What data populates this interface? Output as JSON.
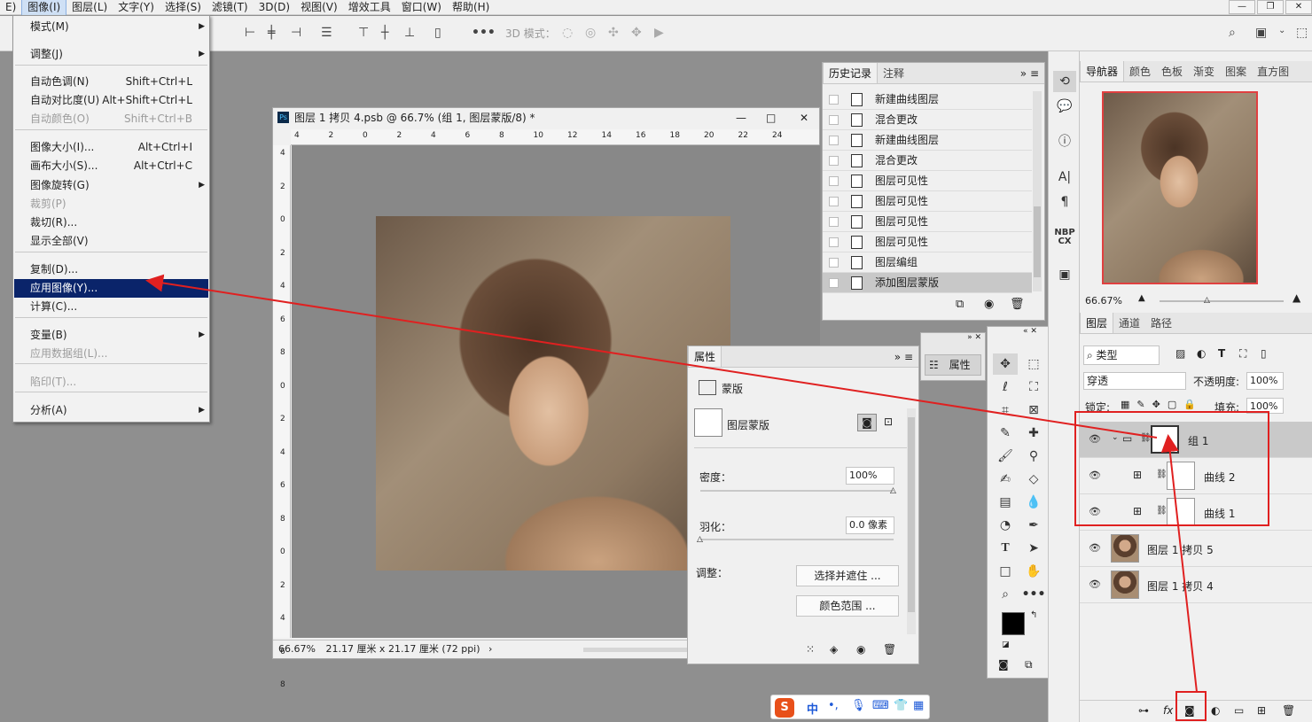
{
  "menubar": {
    "items": [
      "E)",
      "图像(I)",
      "图层(L)",
      "文字(Y)",
      "选择(S)",
      "滤镜(T)",
      "3D(D)",
      "视图(V)",
      "增效工具",
      "窗口(W)",
      "帮助(H)"
    ]
  },
  "options_bar": {
    "mode_label": "3D 模式："
  },
  "image_menu": {
    "items": [
      {
        "label": "模式(M)",
        "shortcut": "",
        "submenu": true,
        "disabled": false
      },
      {
        "label": "调整(J)",
        "shortcut": "",
        "submenu": true,
        "disabled": false
      },
      {
        "label": "自动色调(N)",
        "shortcut": "Shift+Ctrl+L",
        "submenu": false,
        "disabled": false
      },
      {
        "label": "自动对比度(U)",
        "shortcut": "Alt+Shift+Ctrl+L",
        "submenu": false,
        "disabled": false
      },
      {
        "label": "自动颜色(O)",
        "shortcut": "Shift+Ctrl+B",
        "submenu": false,
        "disabled": true
      },
      {
        "label": "图像大小(I)...",
        "shortcut": "Alt+Ctrl+I",
        "submenu": false,
        "disabled": false
      },
      {
        "label": "画布大小(S)...",
        "shortcut": "Alt+Ctrl+C",
        "submenu": false,
        "disabled": false
      },
      {
        "label": "图像旋转(G)",
        "shortcut": "",
        "submenu": true,
        "disabled": false
      },
      {
        "label": "裁剪(P)",
        "shortcut": "",
        "submenu": false,
        "disabled": true
      },
      {
        "label": "裁切(R)...",
        "shortcut": "",
        "submenu": false,
        "disabled": false
      },
      {
        "label": "显示全部(V)",
        "shortcut": "",
        "submenu": false,
        "disabled": false
      },
      {
        "label": "复制(D)...",
        "shortcut": "",
        "submenu": false,
        "disabled": false
      },
      {
        "label": "应用图像(Y)...",
        "shortcut": "",
        "submenu": false,
        "disabled": false,
        "highlighted": true
      },
      {
        "label": "计算(C)...",
        "shortcut": "",
        "submenu": false,
        "disabled": false
      },
      {
        "label": "变量(B)",
        "shortcut": "",
        "submenu": true,
        "disabled": false
      },
      {
        "label": "应用数据组(L)...",
        "shortcut": "",
        "submenu": false,
        "disabled": true
      },
      {
        "label": "陷印(T)...",
        "shortcut": "",
        "submenu": false,
        "disabled": true
      },
      {
        "label": "分析(A)",
        "shortcut": "",
        "submenu": true,
        "disabled": false
      }
    ]
  },
  "document": {
    "title": "图层 1 拷贝 4.psb @ 66.7% (组 1, 图层蒙版/8) *",
    "zoom": "66.67%",
    "size_info": "21.17 厘米 x 21.17 厘米 (72 ppi)",
    "ruler_h": [
      "4",
      "2",
      "0",
      "2",
      "4",
      "6",
      "8",
      "10",
      "12",
      "14",
      "16",
      "18",
      "20",
      "22",
      "24"
    ],
    "ruler_v": [
      "4",
      "2",
      "0",
      "2",
      "4",
      "6",
      "8",
      "0",
      "2",
      "4",
      "6",
      "8",
      "0",
      "2",
      "4",
      "6",
      "8"
    ]
  },
  "history": {
    "tabs": [
      "历史记录",
      "注释"
    ],
    "items": [
      "新建曲线图层",
      "混合更改",
      "新建曲线图层",
      "混合更改",
      "图层可见性",
      "图层可见性",
      "图层可见性",
      "图层可见性",
      "图层编组",
      "添加图层蒙版"
    ],
    "selected_index": 9
  },
  "properties": {
    "tab": "属性",
    "section": "蒙版",
    "mask_label": "图层蒙版",
    "density_label": "密度：",
    "density_value": "100%",
    "density_level": 1.0,
    "feather_label": "羽化：",
    "feather_value": "0.0 像素",
    "feather_level": 0.0,
    "refine_label": "调整：",
    "select_mask_button": "选择并遮住 ...",
    "color_range_button": "颜色范围 ..."
  },
  "props_mini": {
    "label": "属性"
  },
  "navigator": {
    "tabs": [
      "导航器",
      "颜色",
      "色板",
      "渐变",
      "图案",
      "直方图"
    ],
    "zoom": "66.67%"
  },
  "layers": {
    "tabs": [
      "图层",
      "通道",
      "路径"
    ],
    "filter_type": "类型",
    "blend_mode": "穿透",
    "opacity_label": "不透明度:",
    "opacity": "100%",
    "lock_label": "锁定:",
    "fill_label": "填充:",
    "fill": "100%",
    "rows": [
      {
        "name": "组 1",
        "kind": "group"
      },
      {
        "name": "曲线 2",
        "kind": "adjust"
      },
      {
        "name": "曲线 1",
        "kind": "adjust"
      },
      {
        "name": "图层 1 拷贝 5",
        "kind": "photo"
      },
      {
        "name": "图层 1 拷贝 4",
        "kind": "photo"
      }
    ]
  },
  "dock_strip": {
    "nbp_label": "NBP\nCX"
  },
  "ime": {
    "zh": "中",
    "punct": "•,"
  },
  "colors": {
    "menu_highlight": "#0a246a",
    "annotation_red": "#e02020",
    "selected_row": "#c8c8c8"
  }
}
